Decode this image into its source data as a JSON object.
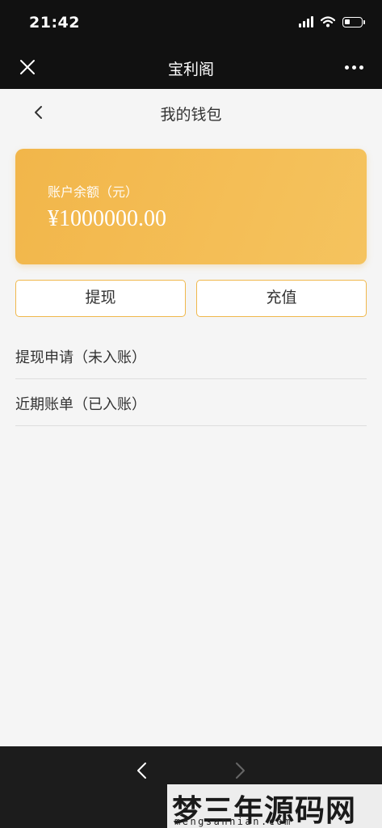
{
  "status_bar": {
    "time": "21:42"
  },
  "title_bar": {
    "title": "宝利阁"
  },
  "page": {
    "title": "我的钱包"
  },
  "balance_card": {
    "label": "账户余额（元）",
    "amount": "¥1000000.00"
  },
  "actions": {
    "withdraw_label": "提现",
    "recharge_label": "充值"
  },
  "list": [
    {
      "label": "提现申请（未入账）"
    },
    {
      "label": "近期账单（已入账）"
    }
  ],
  "watermark": {
    "title": "梦三年源码网",
    "url": "mengsannian.com"
  },
  "colors": {
    "accent": "#f2b64a",
    "bar_background": "#111111",
    "page_background": "#f5f5f5"
  },
  "icons": {
    "close": "close-icon",
    "more": "more-icon",
    "back": "chevron-left-icon",
    "forward": "chevron-right-icon"
  }
}
